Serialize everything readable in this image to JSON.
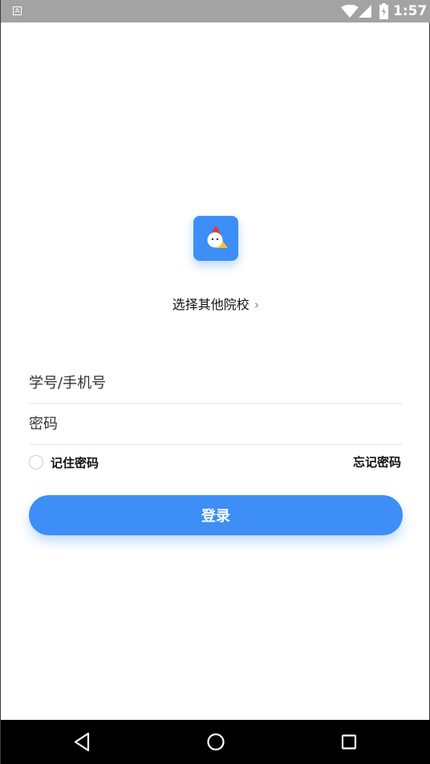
{
  "status_bar": {
    "notification_icon": "A",
    "time": "1:57",
    "icons": [
      "wifi-icon",
      "cellular-signal-icon",
      "battery-charging-icon"
    ]
  },
  "school": {
    "select_label": "选择其他院校",
    "chevron": "›"
  },
  "login_form": {
    "username_placeholder": "学号/手机号",
    "password_placeholder": "密码",
    "remember_label": "记住密码",
    "forgot_label": "忘记密码",
    "login_label": "登录"
  },
  "nav_bar": {
    "icons": [
      "back-icon",
      "home-icon",
      "recent-apps-icon"
    ]
  },
  "colors": {
    "accent": "#3d8ef7",
    "status_bar": "#a3a3a3",
    "nav_bar": "#000000"
  }
}
